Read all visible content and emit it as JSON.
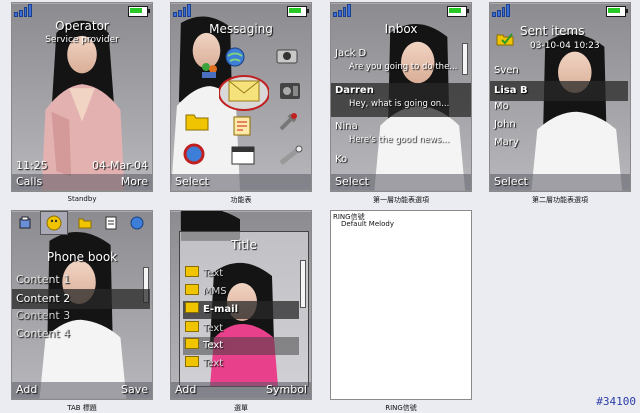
{
  "standby": {
    "operator": "Operator",
    "service_provider": "Service provider",
    "time": "11:25",
    "date": "04-Mar-04",
    "soft_left": "Calls",
    "soft_right": "More",
    "caption": "Standby"
  },
  "messaging": {
    "title": "Messaging",
    "soft_left": "Select",
    "caption": "功能表"
  },
  "inbox": {
    "title": "Inbox",
    "items": [
      {
        "name": "Jack D",
        "preview": "Are you going to do the..."
      },
      {
        "name": "Darren",
        "preview": "Hey, what is going on..."
      },
      {
        "name": "Nina",
        "preview": "Here's the good news..."
      },
      {
        "name": "Ko",
        "preview": ""
      }
    ],
    "soft_left": "Select",
    "caption": "第一層功能表選項"
  },
  "sent": {
    "title": "Sent items",
    "datetime": "03-10-04 10:23",
    "items": [
      "Sven",
      "Lisa B",
      "Mo",
      "John",
      "Mary"
    ],
    "soft_left": "Select",
    "caption": "第二層功能表選項"
  },
  "phonebook": {
    "title": "Phone book",
    "items": [
      "Content 1",
      "Content 2",
      "Content 3",
      "Content 4"
    ],
    "soft_left": "Add",
    "soft_right": "Save",
    "caption": "TAB 標題"
  },
  "menu": {
    "title": "Title",
    "items": [
      "Text",
      "MMS",
      "E-mail",
      "Text",
      "Text",
      "Text"
    ],
    "soft_left": "Add",
    "soft_right": "Symbol",
    "caption": "選單"
  },
  "ring": {
    "label": "RING信號",
    "value": "Default Melody",
    "caption": "RING信號"
  },
  "watermark": "#34100",
  "colors": {
    "accent": "#3b6ed6",
    "highlight": "#2a2a2a",
    "battery": "#27c927"
  }
}
